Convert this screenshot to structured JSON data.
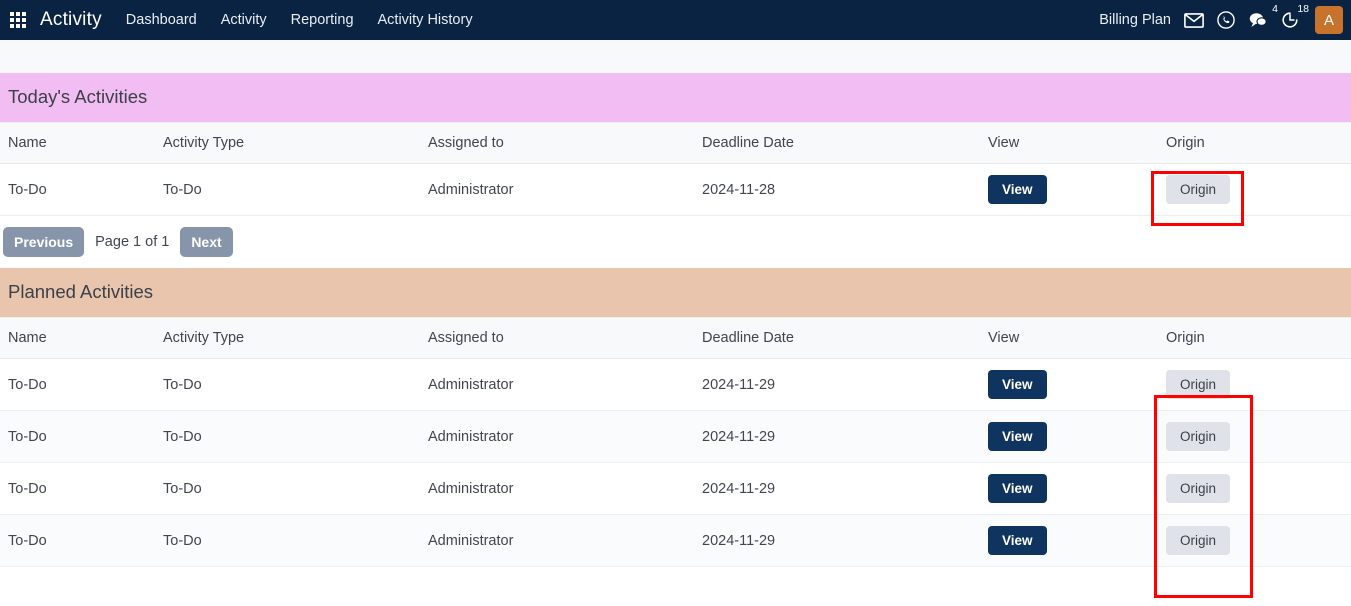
{
  "navbar": {
    "apps_icon": "grid-apps-icon",
    "brand": "Activity",
    "links": [
      {
        "label": "Dashboard"
      },
      {
        "label": "Activity"
      },
      {
        "label": "Reporting"
      },
      {
        "label": "Activity History"
      }
    ],
    "billing_plan": "Billing Plan",
    "icons": [
      {
        "name": "envelope-icon",
        "badge": ""
      },
      {
        "name": "whatsapp-icon",
        "badge": ""
      },
      {
        "name": "chat-bubble-icon",
        "badge": "4"
      },
      {
        "name": "timer-clock-icon",
        "badge": "18"
      }
    ],
    "avatar": "A",
    "colors": {
      "navbar_bg": "#0a2342",
      "avatar_bg": "#c8732c"
    }
  },
  "sections": {
    "today": {
      "title": "Today's Activities",
      "header_color": "#f2bdf2",
      "columns": [
        "Name",
        "Activity Type",
        "Assigned to",
        "Deadline Date",
        "View",
        "Origin"
      ],
      "rows": [
        {
          "name": "To-Do",
          "activity_type": "To-Do",
          "assigned_to": "Administrator",
          "deadline_date": "2024-11-28",
          "view_label": "View",
          "origin_label": "Origin"
        }
      ],
      "pagination": {
        "previous": "Previous",
        "page_info": "Page 1 of 1",
        "next": "Next"
      }
    },
    "planned": {
      "title": "Planned Activities",
      "header_color": "#e8c5ac",
      "columns": [
        "Name",
        "Activity Type",
        "Assigned to",
        "Deadline Date",
        "View",
        "Origin"
      ],
      "rows": [
        {
          "name": "To-Do",
          "activity_type": "To-Do",
          "assigned_to": "Administrator",
          "deadline_date": "2024-11-29",
          "view_label": "View",
          "origin_label": "Origin"
        },
        {
          "name": "To-Do",
          "activity_type": "To-Do",
          "assigned_to": "Administrator",
          "deadline_date": "2024-11-29",
          "view_label": "View",
          "origin_label": "Origin"
        },
        {
          "name": "To-Do",
          "activity_type": "To-Do",
          "assigned_to": "Administrator",
          "deadline_date": "2024-11-29",
          "view_label": "View",
          "origin_label": "Origin"
        },
        {
          "name": "To-Do",
          "activity_type": "To-Do",
          "assigned_to": "Administrator",
          "deadline_date": "2024-11-29",
          "view_label": "View",
          "origin_label": "Origin"
        }
      ]
    }
  },
  "highlights": {
    "color": "#ff0000",
    "today_origin_cell": "Origin",
    "planned_origin_column": "Origin"
  }
}
